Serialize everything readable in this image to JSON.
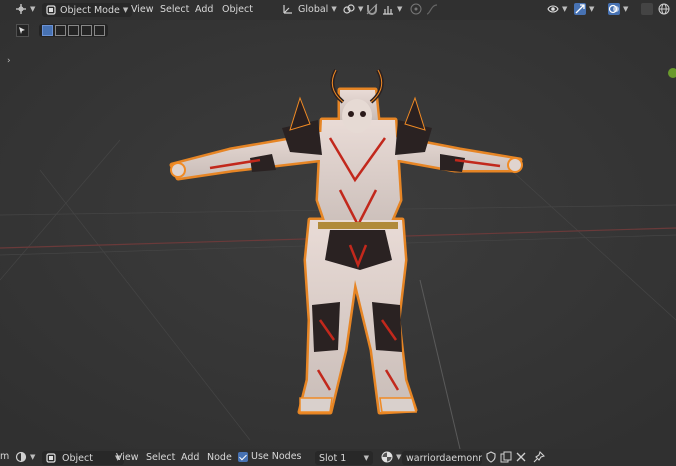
{
  "header": {
    "mode": "Object Mode",
    "menu": [
      "View",
      "Select",
      "Add",
      "Object"
    ],
    "orientation": "Global"
  },
  "footer": {
    "left_letter": "m",
    "object_type": "Object",
    "menu": [
      "View",
      "Select",
      "Add",
      "Node"
    ],
    "use_nodes_label": "Use Nodes",
    "slot": "Slot 1",
    "material": "warriordaemonmat"
  },
  "colors": {
    "accent_blue": "#4772b3",
    "selection_orange": "#f08a24",
    "grid_red": "#6a3a3a",
    "gizmo_green": "#6a9a2c"
  },
  "viewport": {
    "object": "warrior daemon character model"
  }
}
